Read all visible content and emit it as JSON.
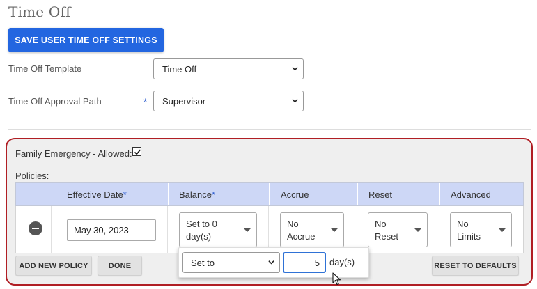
{
  "page": {
    "title": "Time Off"
  },
  "actions": {
    "save_label": "SAVE USER TIME OFF SETTINGS"
  },
  "form": {
    "template": {
      "label": "Time Off Template",
      "value": "Time Off"
    },
    "approval": {
      "label": "Time Off Approval Path",
      "required_mark": "*",
      "value": "Supervisor"
    }
  },
  "policy_group": {
    "name_label": "Family Emergency - Allowed:",
    "allowed_checked": true,
    "policies_label": "Policies:",
    "headers": {
      "effective_date": "Effective Date",
      "balance": "Balance",
      "accrue": "Accrue",
      "reset": "Reset",
      "advanced": "Advanced",
      "required_mark": "*"
    },
    "row": {
      "effective_date": "May 30, 2023",
      "balance_line1": "Set to 0",
      "balance_line2": "day(s)",
      "accrue_line1": "No",
      "accrue_line2": "Accrue",
      "reset_line1": "No",
      "reset_line2": "Reset",
      "advanced_line1": "No",
      "advanced_line2": "Limits"
    },
    "buttons": {
      "add_policy": "ADD NEW POLICY",
      "done": "DONE",
      "reset_defaults": "RESET TO DEFAULTS"
    },
    "balance_popover": {
      "mode": "Set to",
      "amount": "5",
      "unit": "day(s)"
    }
  },
  "colors": {
    "primary": "#2366e0",
    "panel_border": "#b01e24",
    "header_bg": "#cdd7f6",
    "required": "#2f5fd0"
  },
  "icons": {
    "remove": "minus-circle-icon",
    "select": "chevron-down-icon",
    "dropdown": "caret-down-icon",
    "checkbox": "checkmark-icon",
    "cursor": "mouse-pointer-icon"
  }
}
